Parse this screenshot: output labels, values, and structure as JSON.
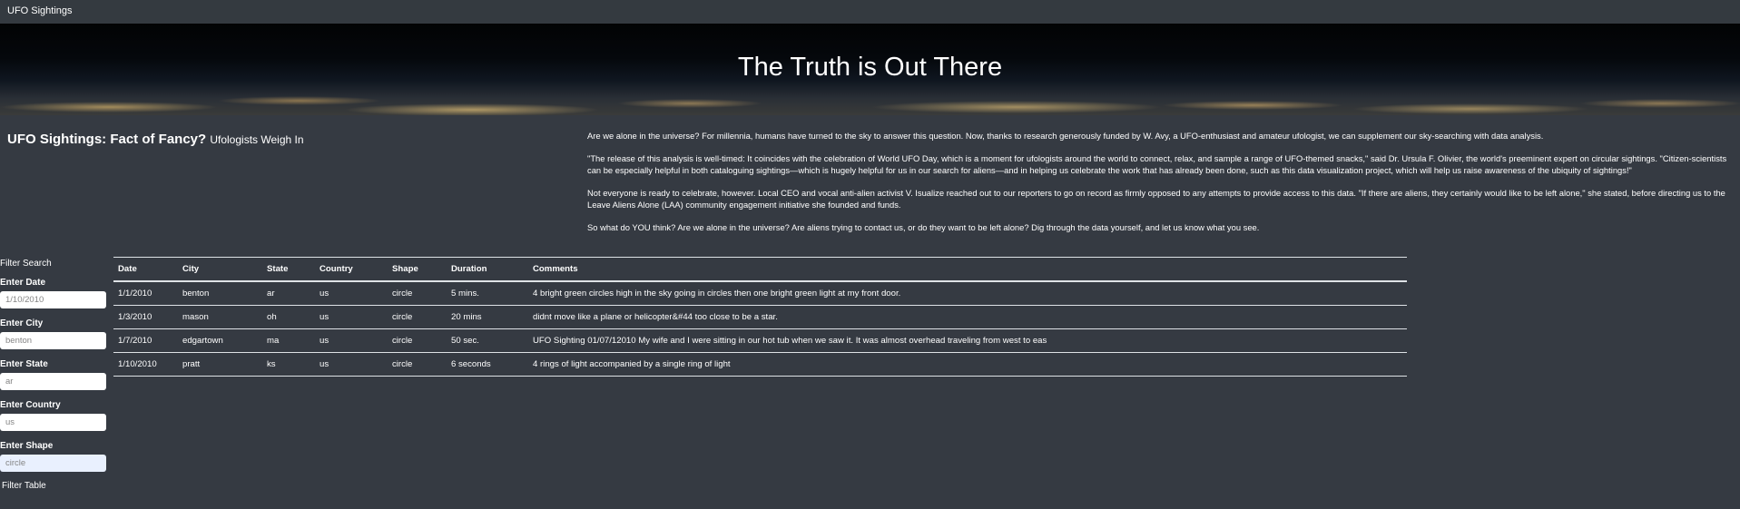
{
  "navbar": {
    "brand": "UFO Sightings"
  },
  "hero": {
    "title": "The Truth is Out There"
  },
  "article": {
    "title": "UFO Sightings: Fact of Fancy?",
    "subtitle": "Ufologists Weigh In",
    "paragraphs": [
      "Are we alone in the universe? For millennia, humans have turned to the sky to answer this question. Now, thanks to research generously funded by W. Avy, a UFO-enthusiast and amateur ufologist, we can supplement our sky-searching with data analysis.",
      "\"The release of this analysis is well-timed: It coincides with the celebration of World UFO Day, which is a moment for ufologists around the world to connect, relax, and sample a range of UFO-themed snacks,\" said Dr. Ursula F. Olivier, the world's preeminent expert on circular sightings. \"Citizen-scientists can be especially helpful in both cataloguing sightings—which is hugely helpful for us in our search for aliens—and in helping us celebrate the work that has already been done, such as this data visualization project, which will help us raise awareness of the ubiquity of sightings!\"",
      "Not everyone is ready to celebrate, however. Local CEO and vocal anti-alien activist V. Isualize reached out to our reporters to go on record as firmly opposed to any attempts to provide access to this data. \"If there are aliens, they certainly would like to be left alone,\" she stated, before directing us to the Leave Aliens Alone (LAA) community engagement initiative she founded and funds.",
      "So what do YOU think? Are we alone in the universe? Are aliens trying to contact us, or do they want to be left alone? Dig through the data yourself, and let us know what you see."
    ]
  },
  "filters": {
    "title": "Filter Search",
    "date": {
      "label": "Enter Date",
      "placeholder": "1/10/2010",
      "value": ""
    },
    "city": {
      "label": "Enter City",
      "placeholder": "benton",
      "value": ""
    },
    "state": {
      "label": "Enter State",
      "placeholder": "ar",
      "value": ""
    },
    "country": {
      "label": "Enter Country",
      "placeholder": "us",
      "value": ""
    },
    "shape": {
      "label": "Enter Shape",
      "placeholder": "circle",
      "value": ""
    },
    "button": "Filter Table"
  },
  "table": {
    "columns": [
      "Date",
      "City",
      "State",
      "Country",
      "Shape",
      "Duration",
      "Comments"
    ],
    "rows": [
      [
        "1/1/2010",
        "benton",
        "ar",
        "us",
        "circle",
        "5 mins.",
        "4 bright green circles high in the sky going in circles then one bright green light at my front door."
      ],
      [
        "1/3/2010",
        "mason",
        "oh",
        "us",
        "circle",
        "20 mins",
        "didnt move like a plane or helicopter&#44 too close to be a star."
      ],
      [
        "1/7/2010",
        "edgartown",
        "ma",
        "us",
        "circle",
        "50 sec.",
        "UFO Sighting 01/07/12010 My wife and I were sitting in our hot tub when we saw it. It was almost overhead traveling from west to eas"
      ],
      [
        "1/10/2010",
        "pratt",
        "ks",
        "us",
        "circle",
        "6 seconds",
        "4 rings of light accompanied by a single ring of light"
      ]
    ]
  }
}
